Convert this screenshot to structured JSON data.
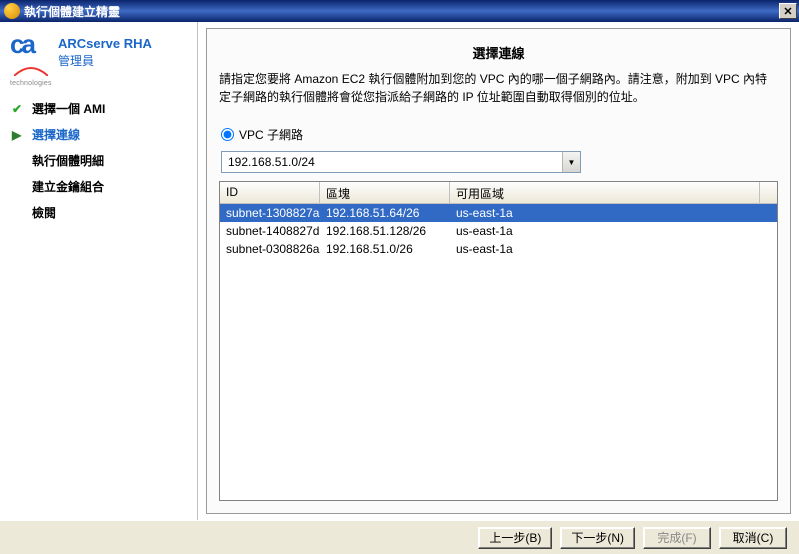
{
  "window": {
    "title": "執行個體建立精靈"
  },
  "branding": {
    "product": "ARCserve RHA",
    "role": "管理員",
    "tech": "technologies"
  },
  "sidebar": {
    "items": [
      {
        "label": "選擇一個 AMI",
        "state": "done"
      },
      {
        "label": "選擇連線",
        "state": "current"
      },
      {
        "label": "執行個體明細",
        "state": "pending"
      },
      {
        "label": "建立金鑰組合",
        "state": "pending"
      },
      {
        "label": "檢閱",
        "state": "pending"
      }
    ]
  },
  "page": {
    "title": "選擇連線",
    "description": "請指定您要將 Amazon EC2 執行個體附加到您的 VPC 內的哪一個子網路內。請注意，附加到 VPC 內特定子網路的執行個體將會從您指派給子網路的 IP 位址範圍自動取得個別的位址。"
  },
  "subnet_group": {
    "radio_label": "VPC 子網路",
    "dropdown_value": "192.168.51.0/24"
  },
  "table": {
    "columns": {
      "id": "ID",
      "block": "區塊",
      "zone": "可用區域"
    },
    "rows": [
      {
        "id": "subnet-1308827a",
        "block": "192.168.51.64/26",
        "zone": "us-east-1a",
        "selected": true
      },
      {
        "id": "subnet-1408827d",
        "block": "192.168.51.128/26",
        "zone": "us-east-1a",
        "selected": false
      },
      {
        "id": "subnet-0308826a",
        "block": "192.168.51.0/26",
        "zone": "us-east-1a",
        "selected": false
      }
    ]
  },
  "footer": {
    "back": "上一步(B)",
    "next": "下一步(N)",
    "finish": "完成(F)",
    "cancel": "取消(C)"
  }
}
